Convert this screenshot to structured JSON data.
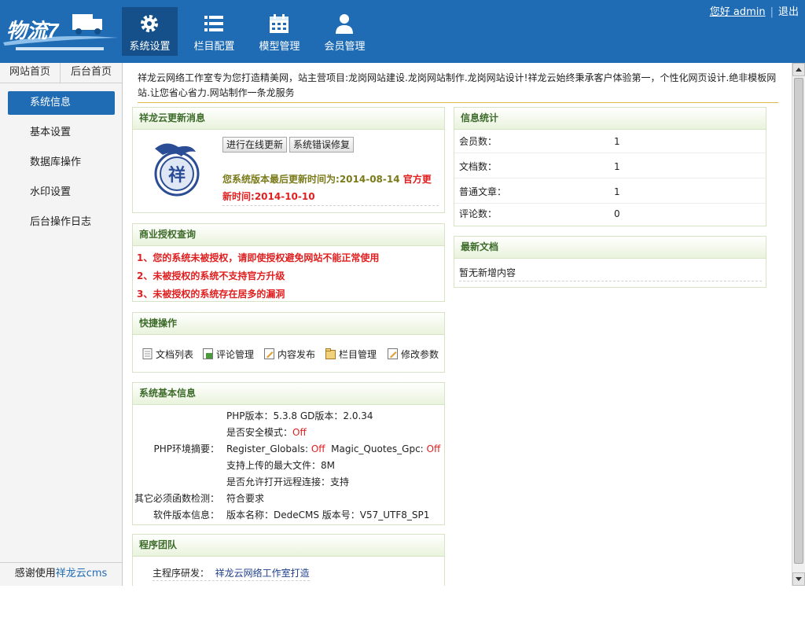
{
  "header": {
    "logo_text": "物流7",
    "nav": [
      {
        "label": "系统设置",
        "icon": "gear-icon"
      },
      {
        "label": "栏目配置",
        "icon": "list-icon"
      },
      {
        "label": "模型管理",
        "icon": "calendar-icon"
      },
      {
        "label": "会员管理",
        "icon": "user-icon"
      }
    ],
    "user": {
      "greeting": "您好 admin",
      "separator": "|",
      "logout": "退出"
    }
  },
  "sidebar": {
    "tabs": [
      "网站首页",
      "后台首页"
    ],
    "items": [
      "系统信息",
      "基本设置",
      "数据库操作",
      "水印设置",
      "后台操作日志"
    ],
    "footer_prefix": "感谢使用",
    "footer_brand": "祥龙云cms"
  },
  "main": {
    "intro": "祥龙云网络工作室专为您打造精美网，站主营项目:龙岗网站建设.龙岗网站制作.龙岗网站设计!祥龙云始终秉承客户体验第一，个性化网页设计.绝非模板网站.让您省心省力.网站制作一条龙服务",
    "update": {
      "title": "祥龙云更新消息",
      "btn_online": "进行在线更新",
      "btn_fix": "系统错误修复",
      "last_update_label": "您系统版本最后更新时间为:",
      "last_update_value": "2014-08-14",
      "official_label": "官方更新时间:",
      "official_value": "2014-10-10"
    },
    "license": {
      "title": "商业授权查询",
      "lines": [
        "1、您的系统未被授权，请即使授权避免网站不能正常使用",
        "2、未被授权的系统不支持官方升级",
        "3、未被授权的系统存在居多的漏洞"
      ]
    },
    "quick": {
      "title": "快捷操作",
      "items": [
        "文档列表",
        "评论管理",
        "内容发布",
        "栏目管理",
        "修改参数"
      ]
    },
    "sysinfo": {
      "title": "系统基本信息",
      "php_version": "PHP版本：5.3.8 GD版本：2.0.34",
      "safe_mode_label": "是否安全模式：",
      "safe_mode_value": "Off",
      "env_label": "PHP环境摘要：",
      "register_globals_label": "Register_Globals:",
      "register_globals_value": "Off",
      "magic_quotes_label": "Magic_Quotes_Gpc:",
      "magic_quotes_value": "Off",
      "max_upload": "支持上传的最大文件：8M",
      "remote_open": "是否允许打开远程连接：支持",
      "func_check_label": "其它必须函数检测：",
      "func_check_value": "符合要求",
      "software_label": "软件版本信息：",
      "software_value": "版本名称：DedeCMS 版本号：V57_UTF8_SP1"
    },
    "team": {
      "title": "程序团队",
      "dev_label": "主程序研发：",
      "dev_value": "祥龙云网络工作室打造"
    },
    "stats": {
      "title": "信息统计",
      "rows": [
        {
          "label": "会员数：",
          "value": "1"
        },
        {
          "label": "文档数：",
          "value": "1"
        },
        {
          "label": "普通文章：",
          "value": "1"
        },
        {
          "label": "评论数：",
          "value": "0"
        }
      ]
    },
    "latest": {
      "title": "最新文档",
      "empty": "暂无新增内容"
    }
  },
  "colors": {
    "header_blue": "#1f6cb5",
    "active_nav": "#15508a",
    "panel_title": "#3d6b2a",
    "warn_red": "#e02020",
    "olive": "#7a7a1a"
  }
}
